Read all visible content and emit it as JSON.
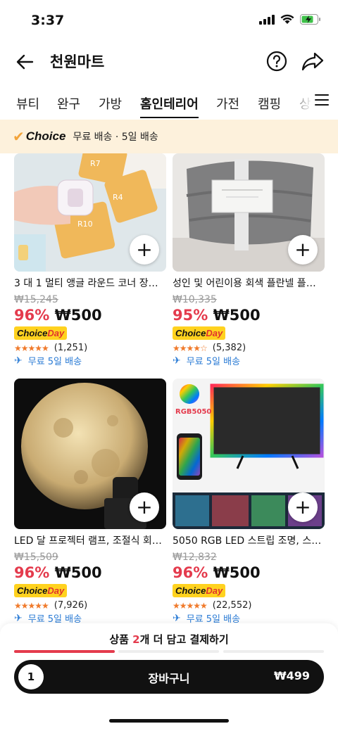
{
  "status_bar": {
    "time": "3:37"
  },
  "header": {
    "title": "천원마트"
  },
  "tabs": [
    "뷰티",
    "완구",
    "가방",
    "홈인테리어",
    "가전",
    "캠핑",
    "상"
  ],
  "active_tab": "홈인테리어",
  "choice_bar": {
    "check": "✔",
    "brand": "Choice",
    "desc": "무료 배송 · 5일 배송"
  },
  "products": [
    {
      "name": "3 대 1 멀티 앵글 라운드 코너 장치 ...",
      "old_price": "₩15,245",
      "discount": "96%",
      "price": "₩500",
      "badge_a": "Choice",
      "badge_b": "Day",
      "stars": "★★★★★",
      "reviews": "(1,251)",
      "shipping": "무료 5일 배송",
      "image_labels": [
        "R7",
        "R4",
        "R10"
      ]
    },
    {
      "name": "성인 및 어린이용 회색 플란넬 플리스...",
      "old_price": "₩10,335",
      "discount": "95%",
      "price": "₩500",
      "badge_a": "Choice",
      "badge_b": "Day",
      "stars": "★★★★☆",
      "reviews": "(5,382)",
      "shipping": "무료 5일 배송"
    },
    {
      "name": "LED 달 프로젝터 램프, 조절식 회전 ...",
      "old_price": "₩15,509",
      "discount": "96%",
      "price": "₩500",
      "badge_a": "Choice",
      "badge_b": "Day",
      "stars": "★★★★★",
      "reviews": "(7,926)",
      "shipping": "무료 5일 배송"
    },
    {
      "name": "5050 RGB LED 스트립 조명, 스마...",
      "old_price": "₩12,832",
      "discount": "96%",
      "price": "₩500",
      "badge_a": "Choice",
      "badge_b": "Day",
      "stars": "★★★★★",
      "reviews": "(22,552)",
      "shipping": "무료 5일 배송",
      "image_labels": [
        "RGB5050"
      ]
    }
  ],
  "promo": {
    "prefix": "상품 ",
    "count": "2",
    "suffix": "개 더 담고 결제하기",
    "progress_segments_filled": 1,
    "progress_segments_total": 3
  },
  "cart": {
    "qty": "1",
    "label": "장바구니",
    "price": "₩499"
  },
  "colors": {
    "accent_red": "#e43b4d",
    "choice_yellow": "#ffd21f",
    "choice_bar_bg": "#fdf1dc",
    "ship_blue": "#2a7bd5",
    "star_orange": "#f07a2b"
  }
}
